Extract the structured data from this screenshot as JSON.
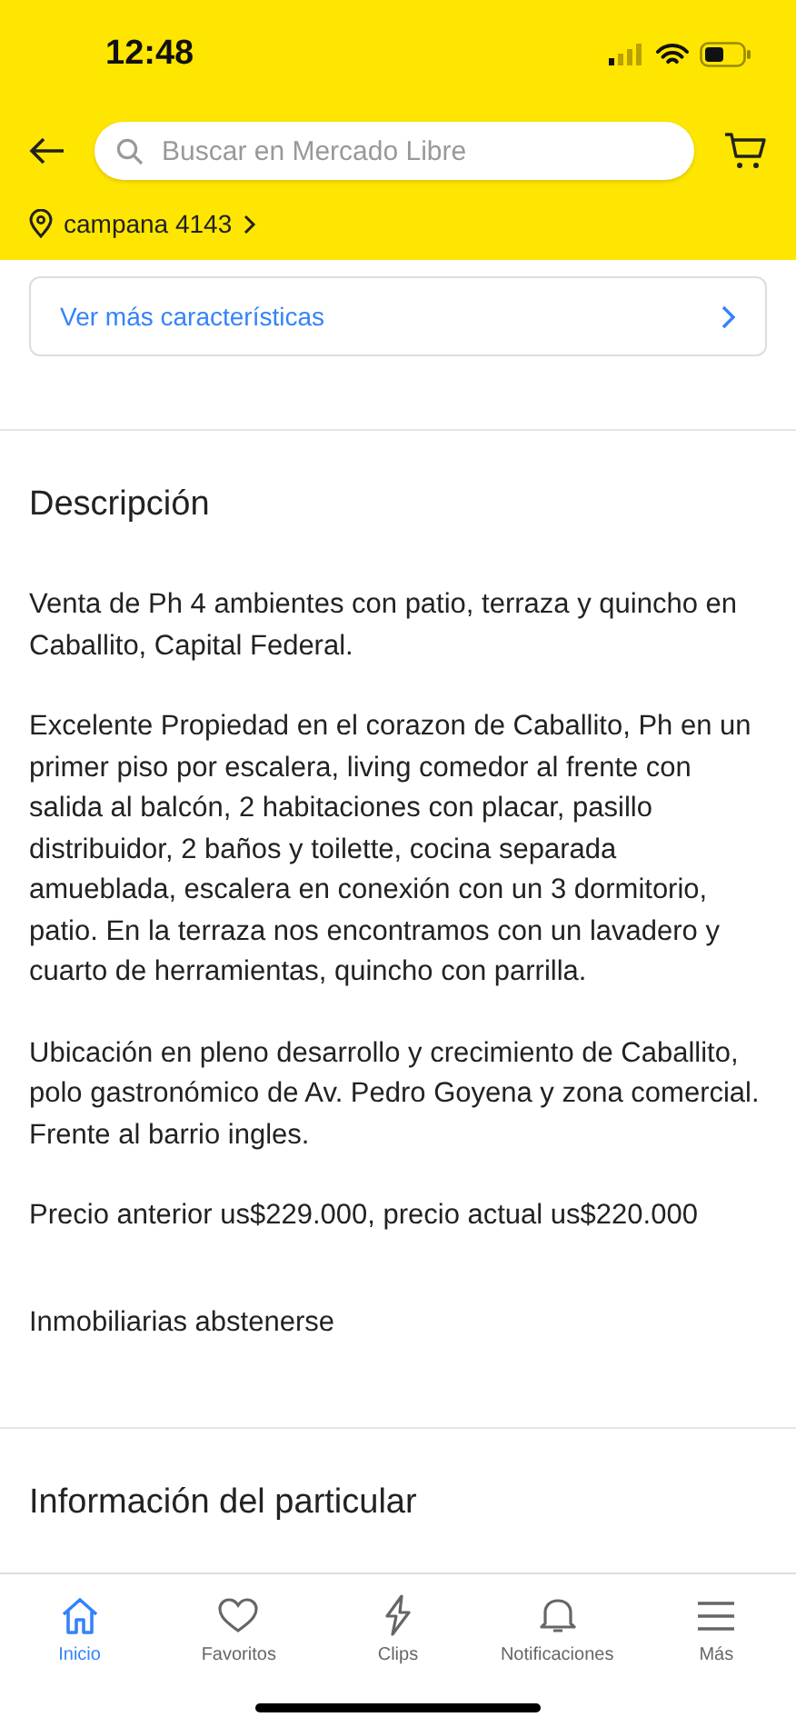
{
  "status_bar": {
    "time": "12:48"
  },
  "header": {
    "search": {
      "placeholder": "Buscar en Mercado Libre"
    },
    "location": "campana 4143"
  },
  "more_link": "Ver más características",
  "description": {
    "title": "Descripción",
    "paragraphs": [
      "Venta de Ph 4 ambientes con patio, terraza y quincho en Caballito, Capital Federal.",
      "Excelente Propiedad en el corazon de Caballito, Ph en un primer piso por escalera, living comedor al frente con salida al balcón, 2 habitaciones con placar, pasillo distribuidor, 2 baños y toilette, cocina separada amueblada, escalera en conexión con un 3 dormitorio, patio. En la terraza nos encontramos con un lavadero y cuarto de herramientas, quincho con parrilla.",
      "Ubicación en pleno desarrollo y crecimiento de Caballito, polo gastronómico de Av. Pedro Goyena y zona comercial. Frente al barrio ingles.",
      "Precio anterior us$229.000, precio actual us$220.000",
      "Inmobiliarias abstenerse"
    ]
  },
  "seller_section": {
    "title": "Información del particular"
  },
  "tab_bar": [
    {
      "label": "Inicio",
      "selected": true
    },
    {
      "label": "Favoritos",
      "selected": false
    },
    {
      "label": "Clips",
      "selected": false
    },
    {
      "label": "Notificaciones",
      "selected": false
    },
    {
      "label": "Más",
      "selected": false
    }
  ]
}
